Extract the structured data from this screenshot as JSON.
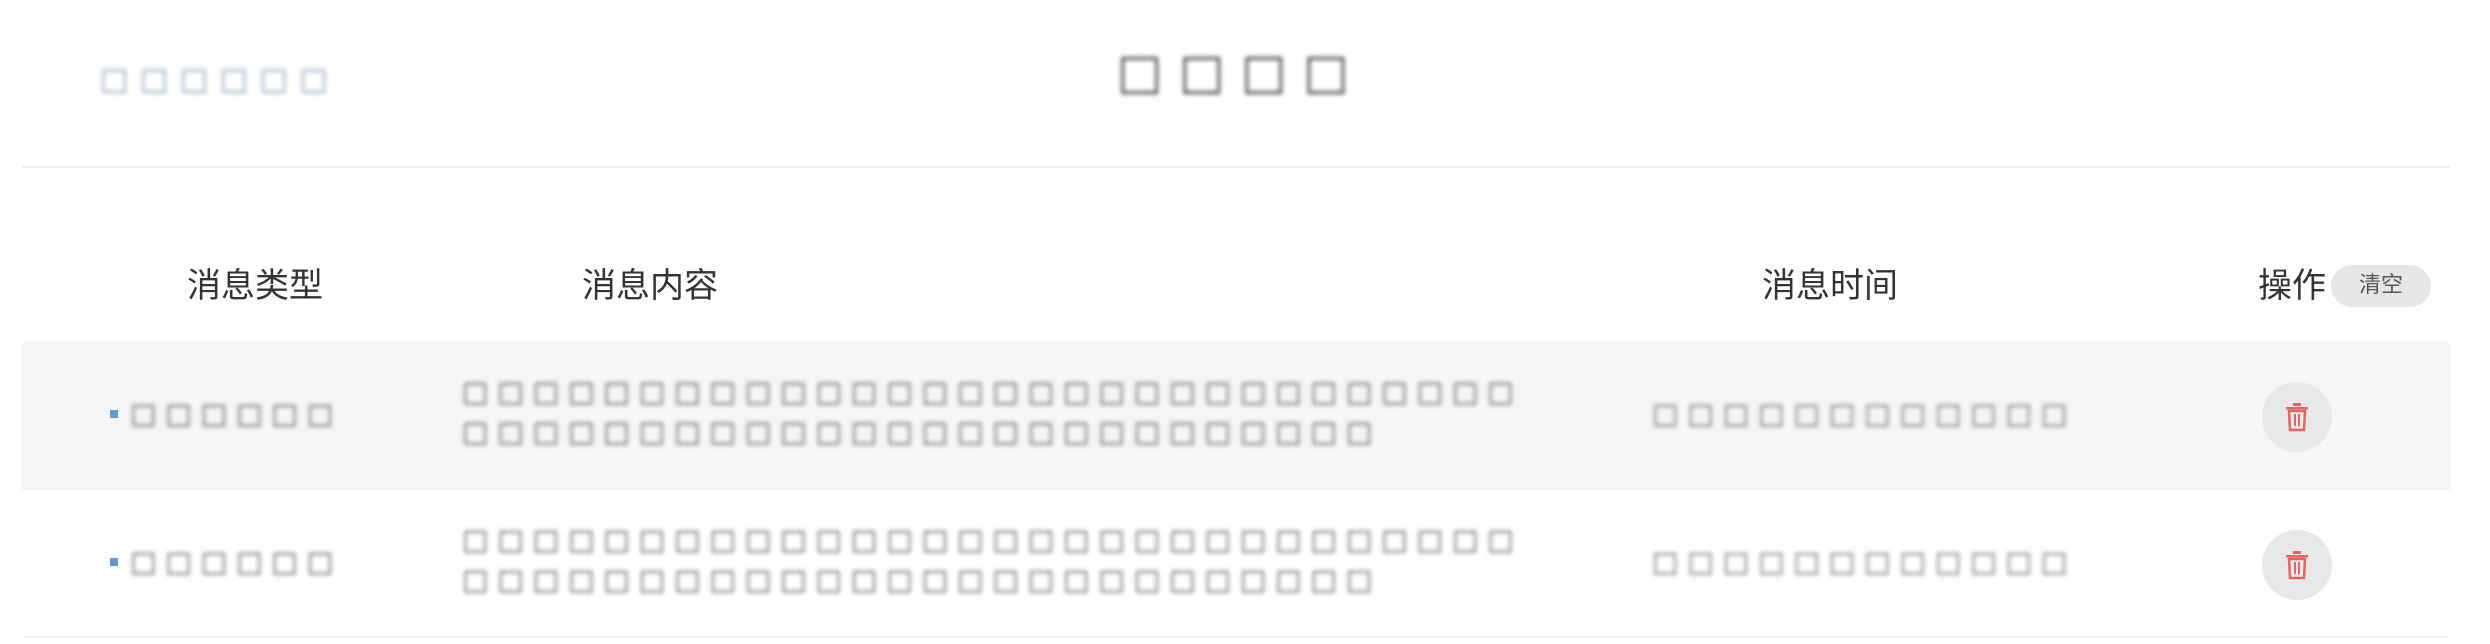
{
  "header": {
    "left_text": "□ □ □ □ □ □",
    "title": "□ □ □ □"
  },
  "table": {
    "columns": {
      "type": "消息类型",
      "content": "消息内容",
      "time": "消息时间",
      "action": "操作"
    },
    "clear_label": "清空",
    "rows": [
      {
        "type": "□ □ □ □ □ □",
        "content": "□ □ □ □ □ □ □ □ □ □ □ □ □ □ □ □ □ □ □ □ □ □ □ □ □ □ □ □ □ □ □ □ □ □ □ □ □ □ □ □ □ □ □ □ □ □ □ □ □ □ □ □ □ □ □ □",
        "time": "□ □ □ □ □ □ □ □ □ □ □ □"
      },
      {
        "type": "□ □ □ □ □ □",
        "content": "□ □ □ □ □ □ □ □ □ □ □ □ □ □ □ □ □ □ □ □ □ □ □ □ □ □ □ □ □ □ □ □ □ □ □ □ □ □ □ □ □ □ □ □ □ □ □ □ □ □ □ □ □ □ □ □",
        "time": "□ □ □ □ □ □ □ □ □ □ □ □"
      }
    ]
  },
  "colors": {
    "accent_blue": "#5b9bd5",
    "delete_icon": "#e06666",
    "row_alt_bg": "#f6f6f6"
  },
  "icons": {
    "delete": "trash-icon",
    "bullet": "square-bullet"
  }
}
